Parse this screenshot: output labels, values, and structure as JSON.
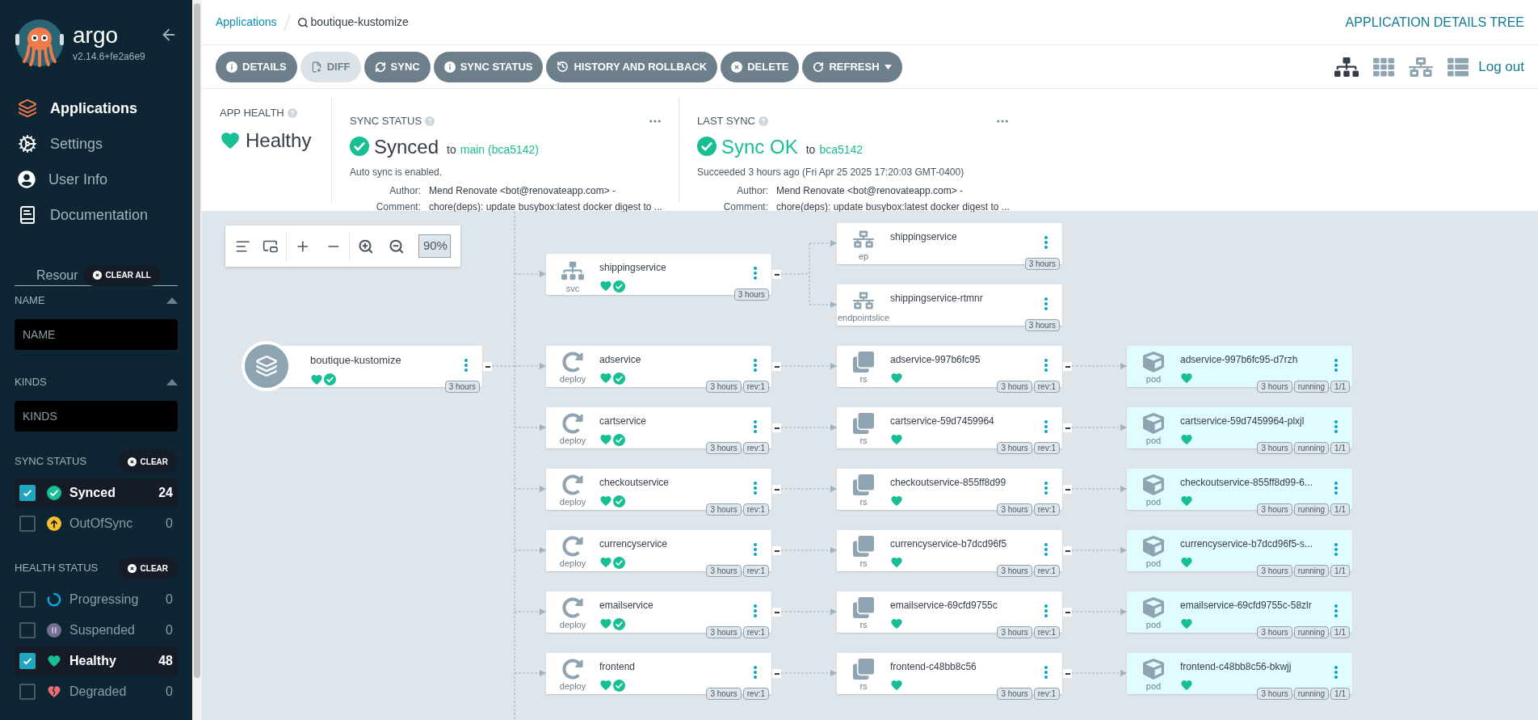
{
  "sidebar": {
    "brand": "argo",
    "version": "v2.14.6+fe2a6e9",
    "nav": [
      {
        "label": "Applications",
        "kind": "applications",
        "selected": true
      },
      {
        "label": "Settings",
        "kind": "settings",
        "selected": false
      },
      {
        "label": "User Info",
        "kind": "user",
        "selected": false
      },
      {
        "label": "Documentation",
        "kind": "docs",
        "selected": false
      }
    ],
    "filter_tab": "Resour",
    "clear_all": "CLEAR ALL",
    "name_filter": {
      "title": "NAME",
      "placeholder": "NAME"
    },
    "kinds_filter": {
      "title": "KINDS",
      "placeholder": "KINDS"
    },
    "sync_status": {
      "title": "SYNC STATUS",
      "clear": "CLEAR",
      "items": [
        {
          "label": "Synced",
          "kind": "synced",
          "count": "24",
          "checked": true
        },
        {
          "label": "OutOfSync",
          "kind": "outofsync",
          "count": "0",
          "checked": false
        }
      ]
    },
    "health_status": {
      "title": "HEALTH STATUS",
      "clear": "CLEAR",
      "items": [
        {
          "label": "Progressing",
          "kind": "progressing",
          "count": "0",
          "checked": false
        },
        {
          "label": "Suspended",
          "kind": "suspended",
          "count": "0",
          "checked": false
        },
        {
          "label": "Healthy",
          "kind": "healthy",
          "count": "48",
          "checked": true
        },
        {
          "label": "Degraded",
          "kind": "degraded",
          "count": "0",
          "checked": false
        }
      ]
    }
  },
  "breadcrumb": {
    "link": "Applications",
    "current": "boutique-kustomize"
  },
  "page_title": "APPLICATION DETAILS TREE",
  "toolbar": {
    "buttons": [
      {
        "label": "DETAILS",
        "disabled": false,
        "dropdown": false
      },
      {
        "label": "DIFF",
        "disabled": true,
        "dropdown": false
      },
      {
        "label": "SYNC",
        "disabled": false,
        "dropdown": false
      },
      {
        "label": "SYNC STATUS",
        "disabled": false,
        "dropdown": false
      },
      {
        "label": "HISTORY AND ROLLBACK",
        "disabled": false,
        "dropdown": false
      },
      {
        "label": "DELETE",
        "disabled": false,
        "dropdown": false
      },
      {
        "label": "REFRESH",
        "disabled": false,
        "dropdown": true
      }
    ],
    "views": [
      {
        "kind": "tree",
        "selected": true
      },
      {
        "kind": "grid",
        "selected": false
      },
      {
        "kind": "network",
        "selected": false
      },
      {
        "kind": "list",
        "selected": false
      }
    ],
    "logout": "Log out"
  },
  "summary": {
    "app_health": {
      "title": "APP HEALTH",
      "status": "Healthy",
      "kind": "healthy"
    },
    "sync_status": {
      "title": "SYNC STATUS",
      "status": "Synced",
      "kind": "synced",
      "to": "to",
      "target": "main (bca5142)",
      "note": "Auto sync is enabled.",
      "fields": [
        {
          "label": "Author:",
          "value": "Mend Renovate <bot@renovateapp.com> -"
        },
        {
          "label": "Comment:",
          "value": "chore(deps): update busybox:latest docker digest to ..."
        }
      ]
    },
    "last_sync": {
      "title": "LAST SYNC",
      "status": "Sync OK",
      "kind": "synced",
      "to": "to",
      "target": "bca5142",
      "note": "Succeeded 3 hours ago (Fri Apr 25 2025 17:20:03 GMT-0400)",
      "fields": [
        {
          "label": "Author:",
          "value": "Mend Renovate <bot@renovateapp.com> -"
        },
        {
          "label": "Comment:",
          "value": "chore(deps): update busybox:latest docker digest to ..."
        }
      ]
    }
  },
  "graph": {
    "zoom_level": "90%",
    "root": {
      "name": "boutique-kustomize",
      "kind": "app",
      "healthy": true,
      "synced": true,
      "badges": [
        "3 hours"
      ],
      "children": [
        {
          "name": "shippingservice",
          "kind": "svc",
          "healthy": true,
          "synced": true,
          "badges": [
            "3 hours"
          ],
          "children": [
            {
              "name": "shippingservice",
              "kind": "ep",
              "badges": [
                "3 hours"
              ]
            },
            {
              "name": "shippingservice-rtmnr",
              "kind": "endpointslice",
              "badges": [
                "3 hours"
              ]
            }
          ]
        },
        {
          "name": "adservice",
          "kind": "deploy",
          "healthy": true,
          "synced": true,
          "badges": [
            "3 hours",
            "rev:1"
          ],
          "children": [
            {
              "name": "adservice-997b6fc95",
              "kind": "rs",
              "healthy": true,
              "badges": [
                "3 hours",
                "rev:1"
              ],
              "children": [
                {
                  "name": "adservice-997b6fc95-d7rzh",
                  "kind": "pod",
                  "healthy": true,
                  "badges": [
                    "3 hours",
                    "running",
                    "1/1"
                  ]
                }
              ]
            }
          ]
        },
        {
          "name": "cartservice",
          "kind": "deploy",
          "healthy": true,
          "synced": true,
          "badges": [
            "3 hours",
            "rev:1"
          ],
          "children": [
            {
              "name": "cartservice-59d7459964",
              "kind": "rs",
              "healthy": true,
              "badges": [
                "3 hours",
                "rev:1"
              ],
              "children": [
                {
                  "name": "cartservice-59d7459964-plxjl",
                  "kind": "pod",
                  "healthy": true,
                  "badges": [
                    "3 hours",
                    "running",
                    "1/1"
                  ]
                }
              ]
            }
          ]
        },
        {
          "name": "checkoutservice",
          "kind": "deploy",
          "healthy": true,
          "synced": true,
          "badges": [
            "3 hours",
            "rev:1"
          ],
          "children": [
            {
              "name": "checkoutservice-855ff8d99",
              "kind": "rs",
              "healthy": true,
              "badges": [
                "3 hours",
                "rev:1"
              ],
              "children": [
                {
                  "name": "checkoutservice-855ff8d99-6...",
                  "kind": "pod",
                  "healthy": true,
                  "badges": [
                    "3 hours",
                    "running",
                    "1/1"
                  ]
                }
              ]
            }
          ]
        },
        {
          "name": "currencyservice",
          "kind": "deploy",
          "healthy": true,
          "synced": true,
          "badges": [
            "3 hours",
            "rev:1"
          ],
          "children": [
            {
              "name": "currencyservice-b7dcd96f5",
              "kind": "rs",
              "healthy": true,
              "badges": [
                "3 hours",
                "rev:1"
              ],
              "children": [
                {
                  "name": "currencyservice-b7dcd96f5-s...",
                  "kind": "pod",
                  "healthy": true,
                  "badges": [
                    "3 hours",
                    "running",
                    "1/1"
                  ]
                }
              ]
            }
          ]
        },
        {
          "name": "emailservice",
          "kind": "deploy",
          "healthy": true,
          "synced": true,
          "badges": [
            "3 hours",
            "rev:1"
          ],
          "children": [
            {
              "name": "emailservice-69cfd9755c",
              "kind": "rs",
              "healthy": true,
              "badges": [
                "3 hours",
                "rev:1"
              ],
              "children": [
                {
                  "name": "emailservice-69cfd9755c-58zlr",
                  "kind": "pod",
                  "healthy": true,
                  "badges": [
                    "3 hours",
                    "running",
                    "1/1"
                  ]
                }
              ]
            }
          ]
        },
        {
          "name": "frontend",
          "kind": "deploy",
          "healthy": true,
          "synced": true,
          "badges": [
            "3 hours",
            "rev:1"
          ],
          "children": [
            {
              "name": "frontend-c48bb8c56",
              "kind": "rs",
              "healthy": true,
              "badges": [
                "3 hours",
                "rev:1"
              ],
              "children": [
                {
                  "name": "frontend-c48bb8c56-bkwjj",
                  "kind": "pod",
                  "healthy": true,
                  "badges": [
                    "3 hours",
                    "running",
                    "1/1"
                  ]
                }
              ]
            }
          ]
        }
      ]
    }
  }
}
